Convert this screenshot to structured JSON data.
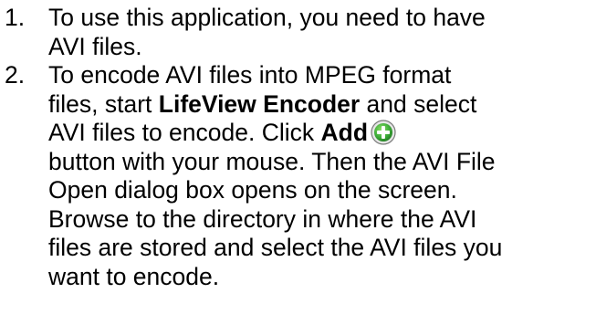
{
  "steps": [
    {
      "number": "1.",
      "lines": [
        "To use this application, you need to have",
        "AVI files."
      ]
    },
    {
      "number": "2.",
      "line1": "To encode AVI files into MPEG format",
      "line2": {
        "pre": "files, start ",
        "bold": "LifeView Encoder",
        "post": " and select"
      },
      "line3": {
        "pre": "AVI files to encode. Click ",
        "bold": "Add",
        "icon": "add-plus-icon"
      },
      "rest": [
        "button with your mouse. Then the AVI File",
        "Open dialog box opens on the screen.",
        "Browse to the directory in where the AVI",
        "files are stored and select the AVI files you",
        "want to encode."
      ]
    }
  ],
  "colors": {
    "text": "#000000",
    "icon_ring": "#7a7a7a",
    "icon_fill": "#3fae3a",
    "icon_plus": "#ffffff"
  }
}
